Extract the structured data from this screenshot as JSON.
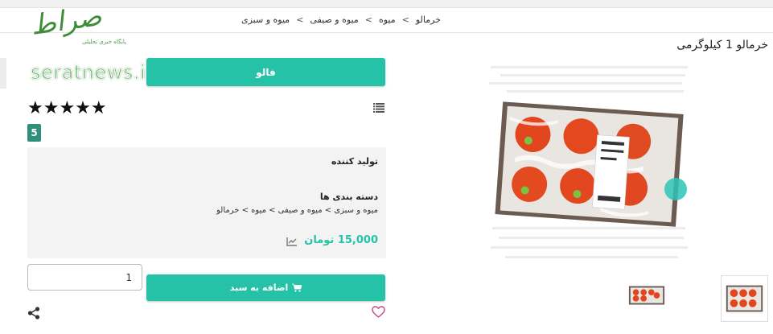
{
  "watermark": {
    "logo_text": "صراط",
    "tagline": "پایگاه خبری تحلیلی",
    "url": "seratnews.ir"
  },
  "breadcrumb": {
    "items": [
      "میوه و سبزی",
      "میوه و صیفی",
      "میوه",
      "خرمالو"
    ],
    "separator": ">"
  },
  "product": {
    "title": "خرمالو 1 کیلوگرمی",
    "brand_button": "فالو",
    "rating_value": "5",
    "stars": "★★★★★",
    "stars_count": 5,
    "manufacturer_label": "تولید کننده",
    "category_label": "دسته بندی ها",
    "category_path": "میوه و سبزی > میوه و صیفی > میوه > خرمالو",
    "price": "15,000 تومان",
    "quantity_value": "1",
    "add_to_cart_label": "اضافه به سبد"
  },
  "icons": {
    "list": "list-icon",
    "chart": "chart-icon",
    "cart": "cart-icon",
    "heart": "heart-icon",
    "share": "share-icon"
  },
  "colors": {
    "accent": "#26c2a7",
    "rating_badge": "#2f8f7a",
    "watermark_green": "#3c8c3a",
    "panel_bg": "#f3f3f3",
    "heart": "#c04a8a"
  }
}
